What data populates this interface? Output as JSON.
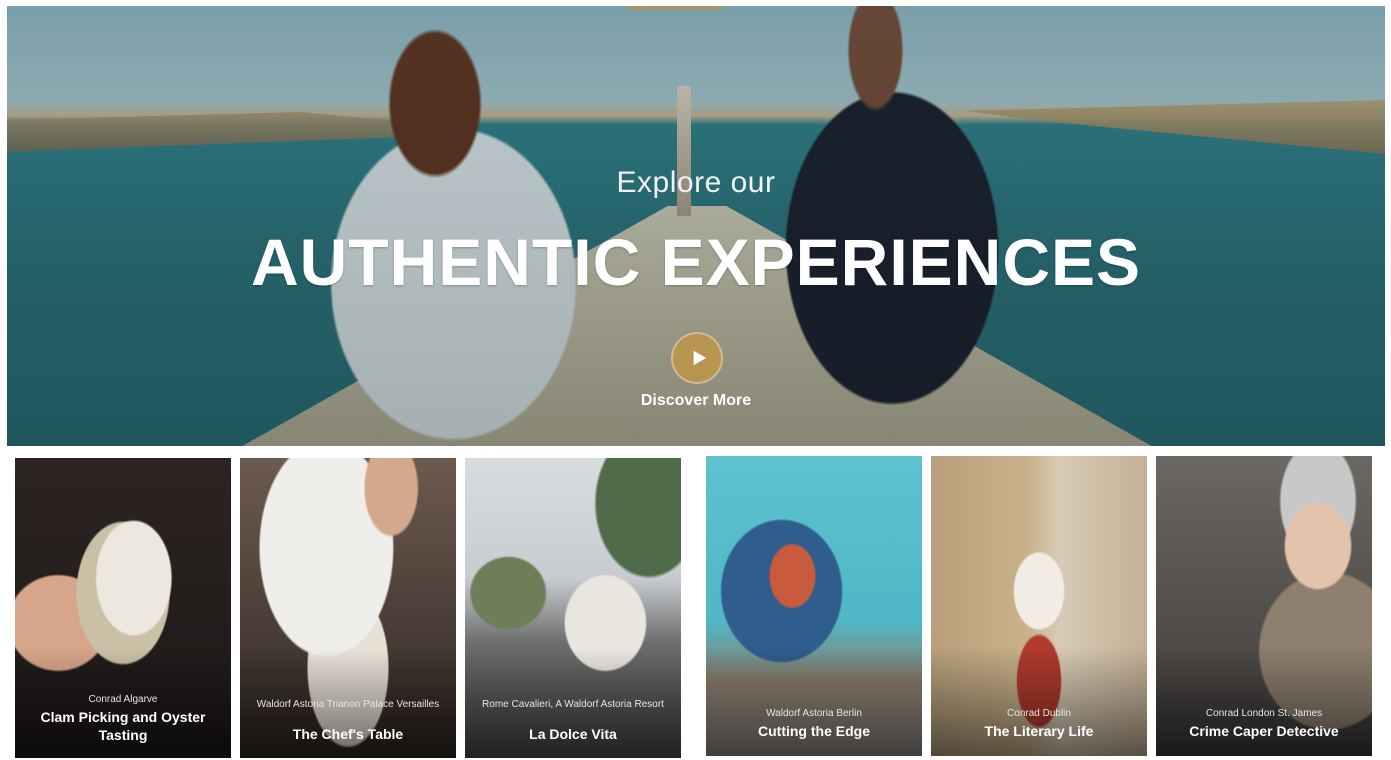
{
  "hero": {
    "subtitle": "Explore our",
    "title": "AUTHENTIC EXPERIENCES",
    "cta_label": "Discover More",
    "accent_color": "#b89a56"
  },
  "cards": [
    {
      "hotel": "Conrad Algarve",
      "title": "Clam Picking and Oyster Tasting"
    },
    {
      "hotel": "Waldorf Astoria Trianon Palace Versailles",
      "title": "The Chef's Table"
    },
    {
      "hotel": "Rome Cavalieri, A Waldorf Astoria Resort",
      "title": "La Dolce Vita"
    },
    {
      "hotel": "Waldorf Astoria Berlin",
      "title": "Cutting the Edge"
    },
    {
      "hotel": "Conrad Dublin",
      "title": "The Literary Life"
    },
    {
      "hotel": "Conrad London St. James",
      "title": "Crime Caper Detective"
    }
  ],
  "icons": {
    "play": "play-icon"
  }
}
